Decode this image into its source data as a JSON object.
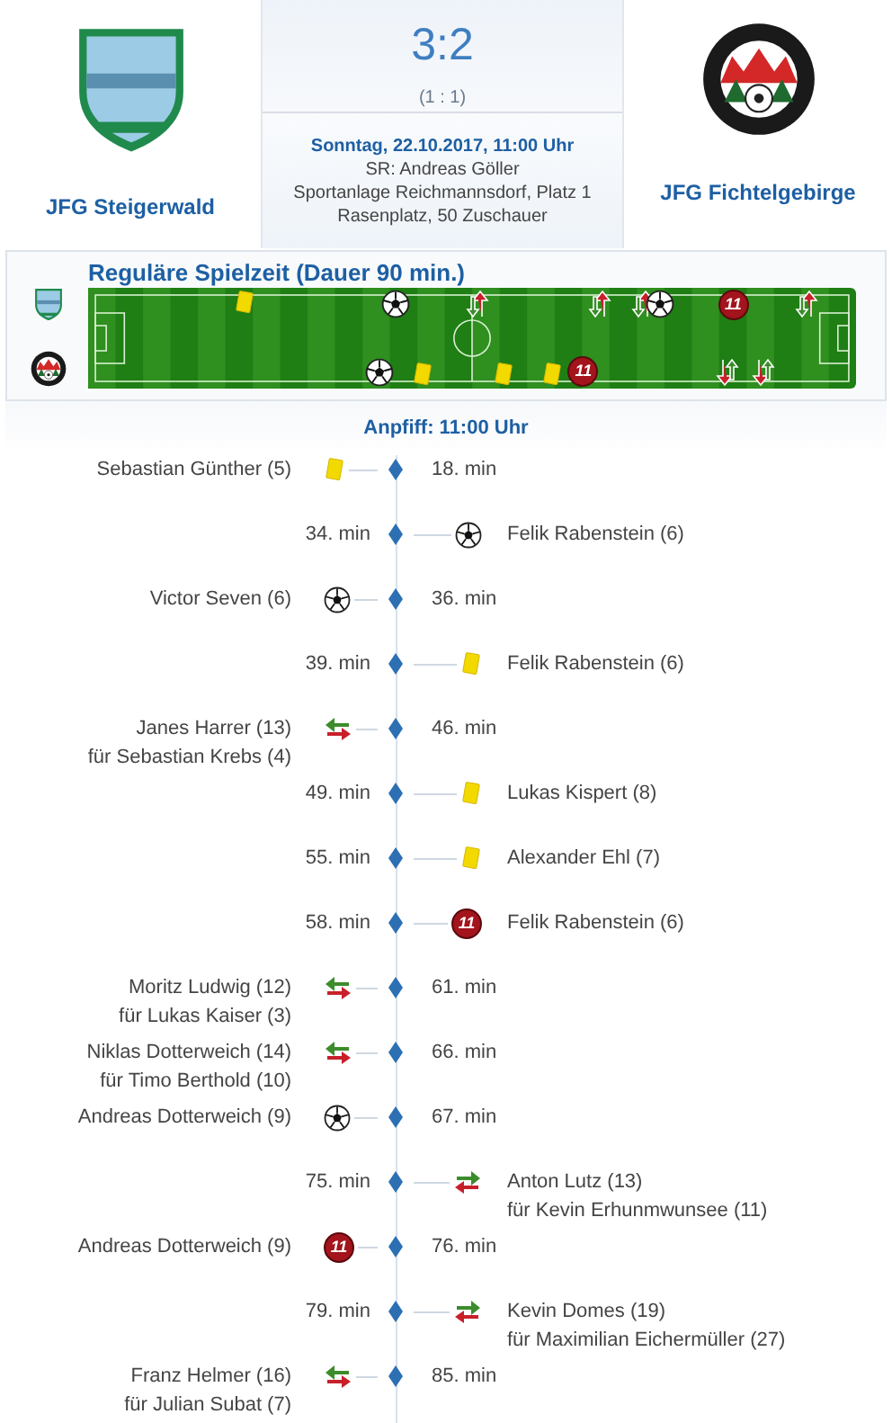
{
  "home": {
    "name": "JFG Steigerwald"
  },
  "away": {
    "name": "JFG Fichtelgebirge"
  },
  "score": "3:2",
  "halftime": "(1 : 1)",
  "info": {
    "date": "Sonntag, 22.10.2017, 11:00 Uhr",
    "referee": "SR: Andreas Göller",
    "venue": "Sportanlage Reichmannsdorf, Platz 1",
    "ground": "Rasenplatz, 50 Zuschauer"
  },
  "timeline_title": "Reguläre Spielzeit (Dauer 90 min.)",
  "pitch_rows": [
    {
      "markers": [
        {
          "kind": "yellow"
        },
        {
          "kind": "goal"
        },
        {
          "kind": "sub"
        },
        {
          "kind": "sub"
        },
        {
          "kind": "sub"
        },
        {
          "kind": "goal"
        },
        {
          "kind": "penalty",
          "label": "11"
        },
        {
          "kind": "sub"
        }
      ]
    },
    {
      "markers": [
        {
          "kind": "goal"
        },
        {
          "kind": "yellow"
        },
        {
          "kind": "yellow"
        },
        {
          "kind": "yellow"
        },
        {
          "kind": "penalty",
          "label": "11"
        },
        {
          "kind": "sub"
        },
        {
          "kind": "sub"
        }
      ]
    }
  ],
  "kickoff": "Anpfiff: 11:00 Uhr",
  "events": [
    {
      "away": false,
      "kind": "yellow",
      "minute": "18. min",
      "player": "Sebastian Günther (5)"
    },
    {
      "away": true,
      "kind": "goal",
      "minute": "34. min",
      "player": "Felik Rabenstein (6)"
    },
    {
      "away": false,
      "kind": "goal",
      "minute": "36. min",
      "player": "Victor Seven (6)"
    },
    {
      "away": true,
      "kind": "yellow",
      "minute": "39. min",
      "player": "Felik Rabenstein (6)"
    },
    {
      "away": false,
      "kind": "sub",
      "minute": "46. min",
      "player": "Janes Harrer (13)",
      "sub_for": "für Sebastian Krebs (4)"
    },
    {
      "away": true,
      "kind": "yellow",
      "minute": "49. min",
      "player": "Lukas Kispert (8)"
    },
    {
      "away": true,
      "kind": "yellow",
      "minute": "55. min",
      "player": "Alexander Ehl (7)"
    },
    {
      "away": true,
      "kind": "penalty",
      "minute": "58. min",
      "player": "Felik Rabenstein (6)",
      "label": "11"
    },
    {
      "away": false,
      "kind": "sub",
      "minute": "61. min",
      "player": "Moritz Ludwig (12)",
      "sub_for": "für Lukas Kaiser (3)"
    },
    {
      "away": false,
      "kind": "sub",
      "minute": "66. min",
      "player": "Niklas Dotterweich (14)",
      "sub_for": "für Timo Berthold (10)"
    },
    {
      "away": false,
      "kind": "goal",
      "minute": "67. min",
      "player": "Andreas Dotterweich (9)"
    },
    {
      "away": true,
      "kind": "sub",
      "minute": "75. min",
      "player": "Anton Lutz (13)",
      "sub_for": "für Kevin Erhunmwunsee (11)"
    },
    {
      "away": false,
      "kind": "penalty",
      "minute": "76. min",
      "player": "Andreas Dotterweich (9)",
      "label": "11"
    },
    {
      "away": true,
      "kind": "sub",
      "minute": "79. min",
      "player": "Kevin Domes (19)",
      "sub_for": "für Maximilian Eichermüller (27)"
    },
    {
      "away": false,
      "kind": "sub",
      "minute": "85. min",
      "player": "Franz Helmer (16)",
      "sub_for": "für Julian Subat (7)"
    }
  ]
}
